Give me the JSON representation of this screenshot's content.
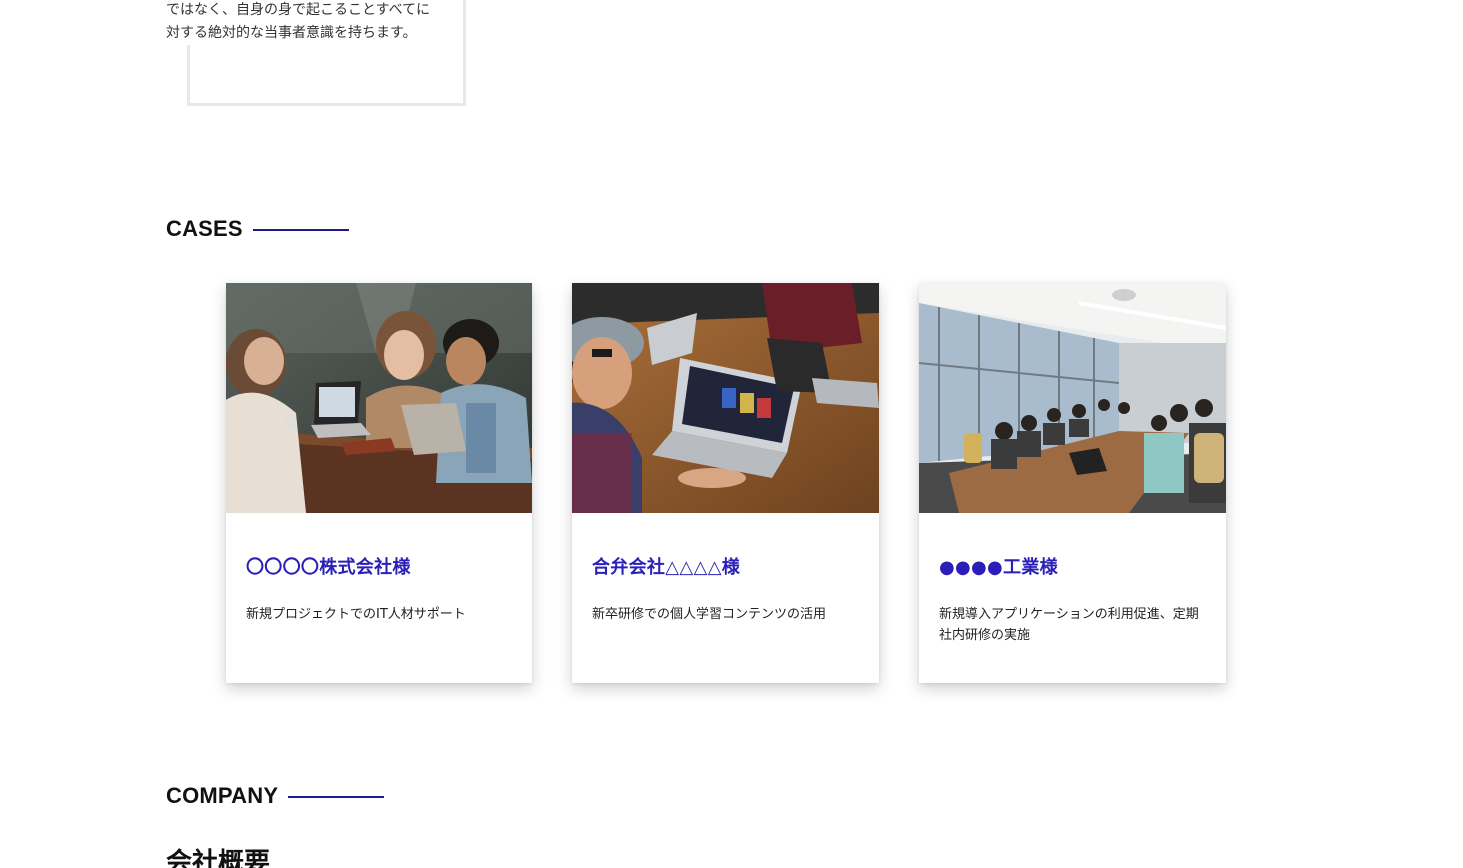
{
  "intro_card": {
    "text": "ではなく、自身の身で起こることすべてに対する絶対的な当事者意識を持ちます。"
  },
  "cases": {
    "heading": "CASES",
    "items": [
      {
        "title": "〇〇〇〇株式会社様",
        "description": "新規プロジェクトでのIT人材サポート"
      },
      {
        "title": "合弁会社△△△△様",
        "description": "新卒研修での個人学習コンテンツの活用"
      },
      {
        "title": "●●●●工業様",
        "description": "新規導入アプリケーションの利用促進、定期社内研修の実施"
      }
    ]
  },
  "company": {
    "heading": "COMPANY",
    "title": "会社概要"
  },
  "colors": {
    "accent": "#2a1fb8",
    "rule": "#1f1a8a"
  }
}
